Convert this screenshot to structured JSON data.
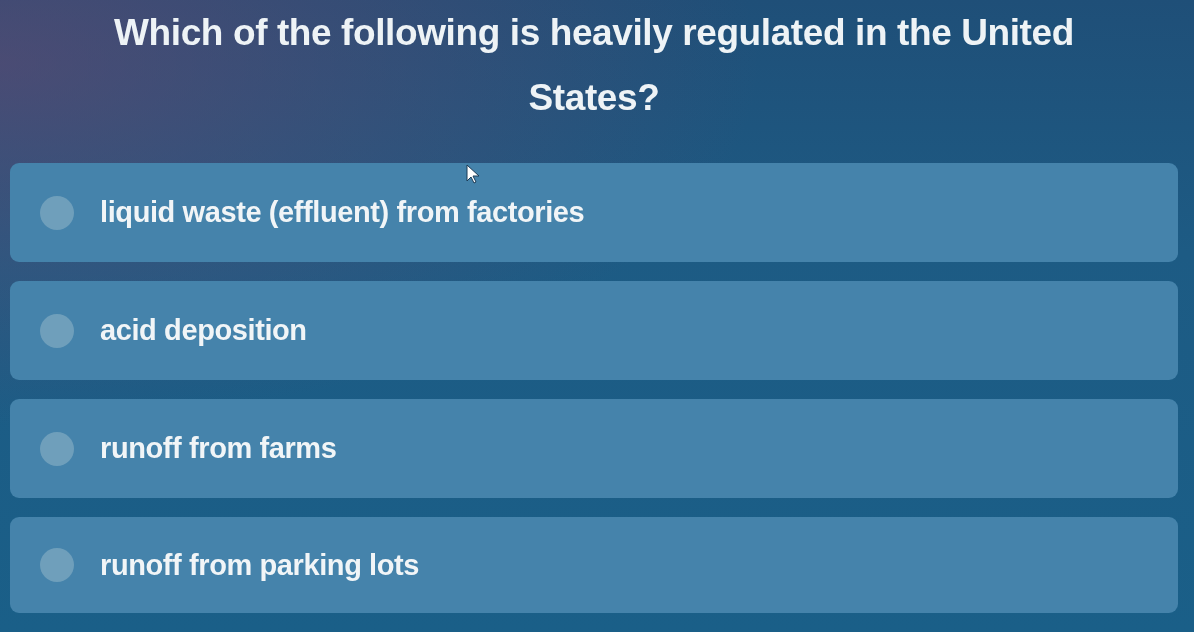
{
  "question": "Which of the following is heavily regulated in the United States?",
  "options": [
    {
      "label": "liquid waste (effluent) from factories",
      "selected": false
    },
    {
      "label": "acid deposition",
      "selected": false
    },
    {
      "label": "runoff from farms",
      "selected": false
    },
    {
      "label": "runoff from parking lots",
      "selected": false
    }
  ]
}
